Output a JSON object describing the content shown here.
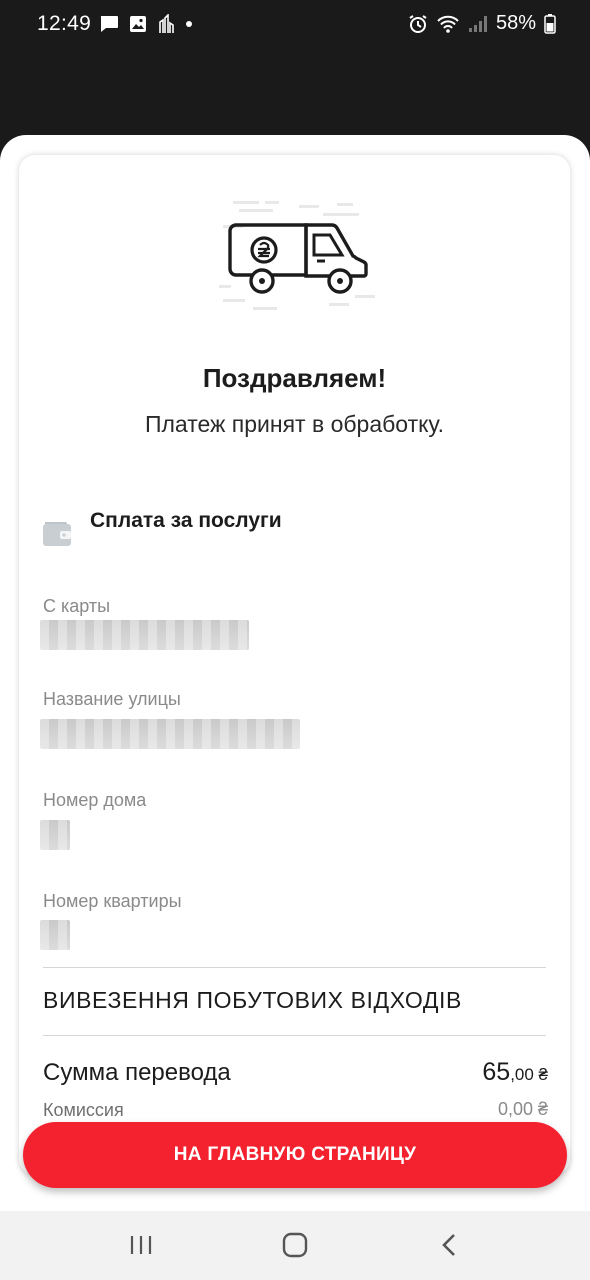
{
  "status_bar": {
    "time": "12:49",
    "battery": "58%",
    "left_icons": [
      "message-icon",
      "gallery-icon",
      "app-notification-icon",
      "dot-icon"
    ],
    "right_icons": [
      "alarm-icon",
      "wifi-icon",
      "signal-icon",
      "battery-icon"
    ]
  },
  "receipt": {
    "illustration": "money-van-icon",
    "title": "Поздравляем!",
    "subtitle": "Платеж принят в обработку.",
    "service_icon": "wallet-icon",
    "service_name": "Сплата за послуги",
    "fields": [
      {
        "label": "С карты"
      },
      {
        "label": "Название улицы"
      },
      {
        "label": "Номер дома"
      },
      {
        "label": "Номер квартиры"
      }
    ],
    "provider": "ВИВЕЗЕННЯ ПОБУТОВИХ ВІДХОДІВ",
    "amount": {
      "label": "Сумма перевода",
      "integer": "65",
      "decimal": ",00 ₴"
    },
    "fee": {
      "label": "Комиссия",
      "value": "0,00 ₴"
    }
  },
  "main_button": {
    "label": "НА ГЛАВНУЮ СТРАНИЦУ"
  },
  "nav_bar": {
    "icons": [
      "recent-apps-icon",
      "home-icon",
      "back-icon"
    ]
  },
  "colors": {
    "accent": "#f4222f",
    "status_bar_bg": "#1a1a1a",
    "label_gray": "#8a8a8a"
  }
}
